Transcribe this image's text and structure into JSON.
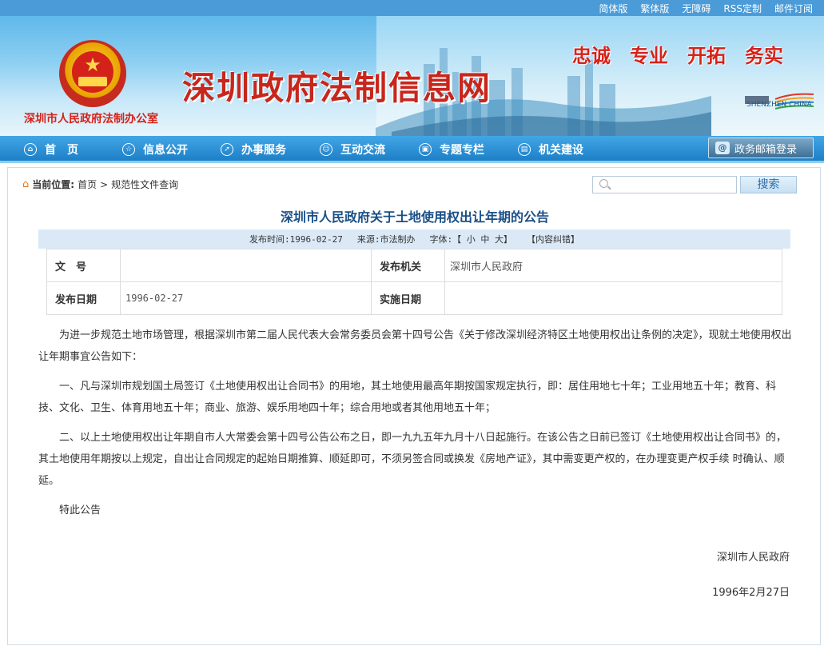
{
  "topbar": {
    "links": [
      "简体版",
      "繁体版",
      "无障碍",
      "RSS定制",
      "邮件订阅"
    ]
  },
  "banner": {
    "office_name": "深圳市人民政府法制办公室",
    "site_title": "深圳政府法制信息网",
    "mottos": [
      "忠诚",
      "专业",
      "开拓",
      "务实"
    ],
    "sz_logo_text": "SHENZHEN CHINA"
  },
  "nav": {
    "items": [
      {
        "label": "首　页",
        "icon": "home-icon"
      },
      {
        "label": "信息公开",
        "icon": "star-icon"
      },
      {
        "label": "办事服务",
        "icon": "compass-icon"
      },
      {
        "label": "互动交流",
        "icon": "people-icon"
      },
      {
        "label": "专题专栏",
        "icon": "topic-icon"
      },
      {
        "label": "机关建设",
        "icon": "book-icon"
      }
    ],
    "mail_button": "政务邮箱登录"
  },
  "breadcrumb": {
    "label": "当前位置:",
    "items": [
      "首页",
      ">",
      "规范性文件查询"
    ]
  },
  "search": {
    "button": "搜索",
    "placeholder": ""
  },
  "document": {
    "title": "深圳市人民政府关于土地使用权出让年期的公告",
    "meta": {
      "publish_time_label": "发布时间:",
      "publish_time": "1996-02-27",
      "source_label": "来源:",
      "source": "市法制办",
      "font_label": "字体:",
      "font_open": "【",
      "font_small": "小",
      "font_medium": "中",
      "font_large": "大",
      "font_close": "】",
      "error_link": "【内容纠错】"
    },
    "info_table": {
      "doc_no_label": "文　号",
      "doc_no": "",
      "issuer_label": "发布机关",
      "issuer": "深圳市人民政府",
      "date_label": "发布日期",
      "date": "1996-02-27",
      "effective_label": "实施日期",
      "effective": ""
    },
    "paragraphs": [
      "为进一步规范土地市场管理，根据深圳市第二届人民代表大会常务委员会第十四号公告《关于修改深圳经济特区土地使用权出让条例的决定》，现就土地使用权出让年期事宜公告如下：",
      "一、凡与深圳市规划国土局签订《土地使用权出让合同书》的用地，其土地使用最高年期按国家规定执行，即：居住用地七十年；工业用地五十年；教育、科技、文化、卫生、体育用地五十年；商业、旅游、娱乐用地四十年；综合用地或者其他用地五十年；",
      "二、以上土地使用权出让年期自市人大常委会第十四号公告公布之日，即一九九五年九月十八日起施行。在该公告之日前已签订《土地使用权出让合同书》的，其土地使用年期按以上规定，自出让合同规定的起始日期推算、顺延即可，不须另签合同或换发《房地产证》，其中需变更产权的，在办理变更产权手续 时确认、顺延。",
      "特此公告"
    ],
    "signature": "深圳市人民政府",
    "sign_date": "1996年2月27日"
  }
}
